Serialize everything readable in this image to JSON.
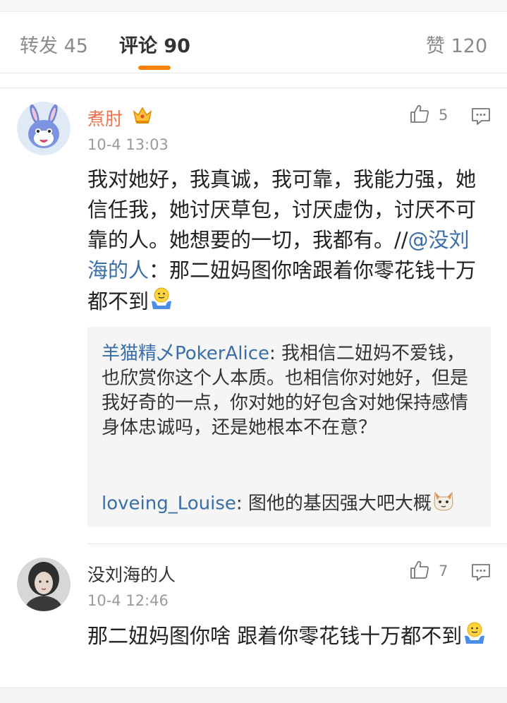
{
  "tabs": {
    "repost": "转发 45",
    "comments": "评论 90",
    "likes": "赞 120"
  },
  "comments": [
    {
      "username": "煮肘",
      "time": "10-4 13:03",
      "likes": "5",
      "text_part1": "我对她好，我真诚，我可靠，我能力强，她信任我，她讨厌草包，讨厌虚伪，讨厌不可靠的人。她想要的一切，我都有。//",
      "mention": "@没刘海的人",
      "text_part2": "：那二妞妈图你啥跟着你零花钱十万都不到",
      "replies": [
        {
          "user": "羊猫精乄PokerAlice",
          "text": ": 我相信二妞妈不爱钱，也欣赏你这个人本质。也相信你对她好，但是我好奇的一点，你对她的好包含对她保持感情身体忠诚吗，还是她根本不在意？"
        },
        {
          "user": "loveing_Louise",
          "text": ": 图他的基因强大吧大概"
        }
      ]
    },
    {
      "username": "没刘海的人",
      "time": "10-4 12:46",
      "likes": "7",
      "text": "那二妞妈图你啥 跟着你零花钱十万都不到"
    }
  ],
  "colors": {
    "accent": "#ff8200",
    "vip_name": "#eb7350",
    "link": "#3a6ea8"
  }
}
